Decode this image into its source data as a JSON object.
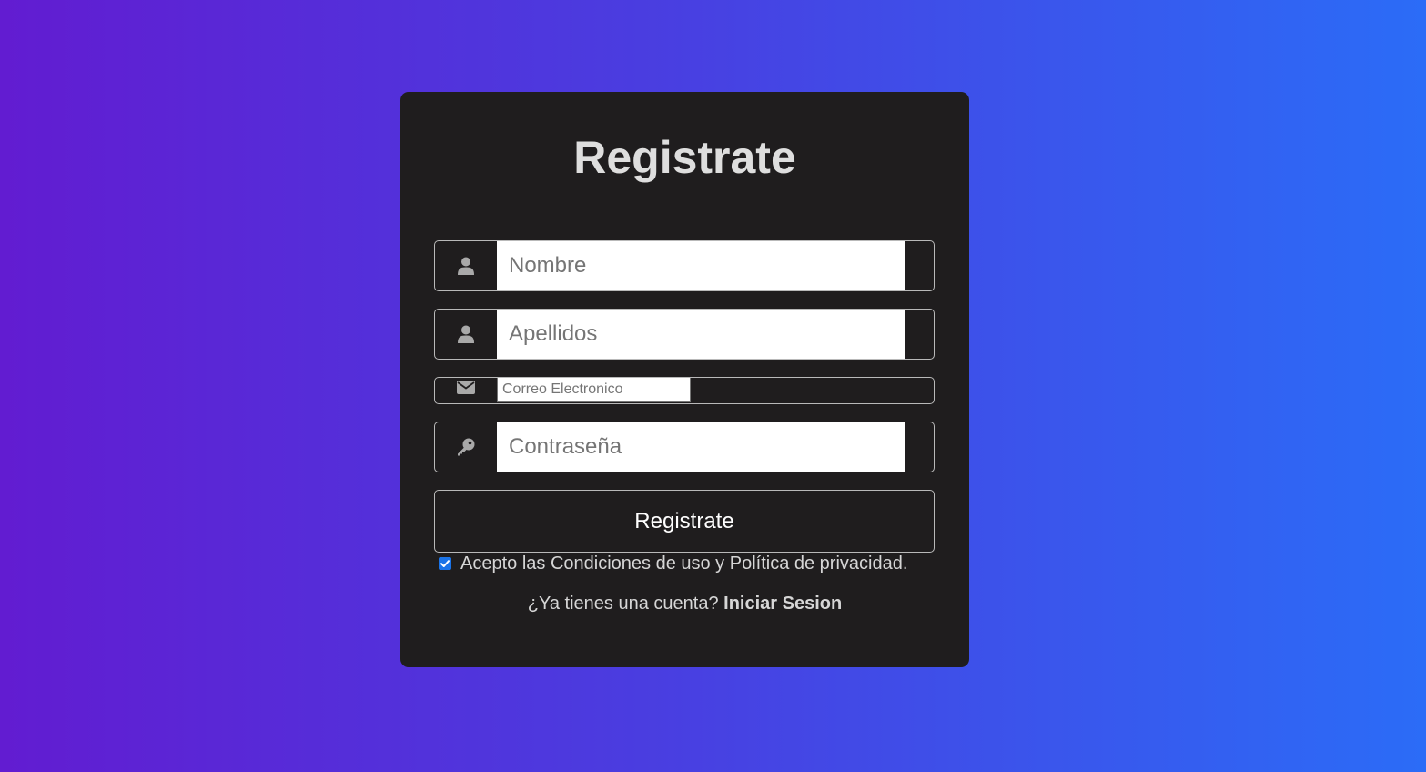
{
  "form": {
    "title": "Registrate",
    "fields": {
      "nombre": {
        "placeholder": "Nombre",
        "value": "",
        "icon": "user-icon"
      },
      "apellidos": {
        "placeholder": "Apellidos",
        "value": "",
        "icon": "user-icon"
      },
      "correo": {
        "placeholder": "Correo Electronico",
        "value": "",
        "icon": "envelope-icon"
      },
      "contrasena": {
        "placeholder": "Contraseña",
        "value": "",
        "icon": "key-icon"
      }
    },
    "submit_label": "Registrate",
    "terms_label": "Acepto las Condiciones de uso y Política de privacidad.",
    "terms_checked": true,
    "login_prompt": "¿Ya tienes una cuenta?",
    "login_link": "Iniciar Sesion"
  },
  "colors": {
    "card_background": "#1f1d1e",
    "gradient_start": "#621cd1",
    "gradient_end": "#2b6cf7",
    "checkbox_accent": "#1a73e8"
  }
}
